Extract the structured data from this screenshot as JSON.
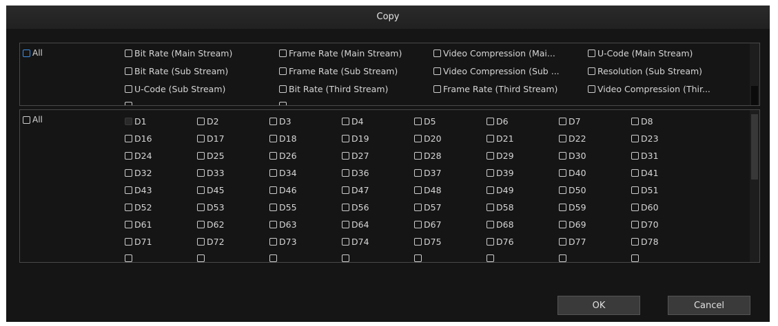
{
  "dialog": {
    "title": "Copy",
    "ok_label": "OK",
    "cancel_label": "Cancel"
  },
  "params": {
    "all_label": "All",
    "rows": [
      [
        "Bit Rate (Main Stream)",
        "Frame Rate (Main Stream)",
        "Video Compression (Mai...",
        "U-Code (Main Stream)"
      ],
      [
        "Bit Rate (Sub Stream)",
        "Frame Rate (Sub Stream)",
        "Video Compression (Sub ...",
        "Resolution (Sub Stream)"
      ],
      [
        "U-Code (Sub Stream)",
        "Bit Rate (Third Stream)",
        "Frame Rate (Third Stream)",
        "Video Compression (Thir..."
      ]
    ]
  },
  "channels": {
    "all_label": "All",
    "rows": [
      [
        "D1",
        "D2",
        "D3",
        "D4",
        "D5",
        "D6",
        "D7",
        "D8"
      ],
      [
        "D16",
        "D17",
        "D18",
        "D19",
        "D20",
        "D21",
        "D22",
        "D23"
      ],
      [
        "D24",
        "D25",
        "D26",
        "D27",
        "D28",
        "D29",
        "D30",
        "D31"
      ],
      [
        "D32",
        "D33",
        "D34",
        "D36",
        "D37",
        "D39",
        "D40",
        "D41"
      ],
      [
        "D43",
        "D45",
        "D46",
        "D47",
        "D48",
        "D49",
        "D50",
        "D51"
      ],
      [
        "D52",
        "D53",
        "D55",
        "D56",
        "D57",
        "D58",
        "D59",
        "D60"
      ],
      [
        "D61",
        "D62",
        "D63",
        "D64",
        "D67",
        "D68",
        "D69",
        "D70"
      ],
      [
        "D71",
        "D72",
        "D73",
        "D74",
        "D75",
        "D76",
        "D77",
        "D78"
      ]
    ],
    "disabled": [
      "D1"
    ]
  },
  "colors": {
    "accent": "#3b8fe6",
    "background": "#151515",
    "button": "#3a3a3a"
  }
}
